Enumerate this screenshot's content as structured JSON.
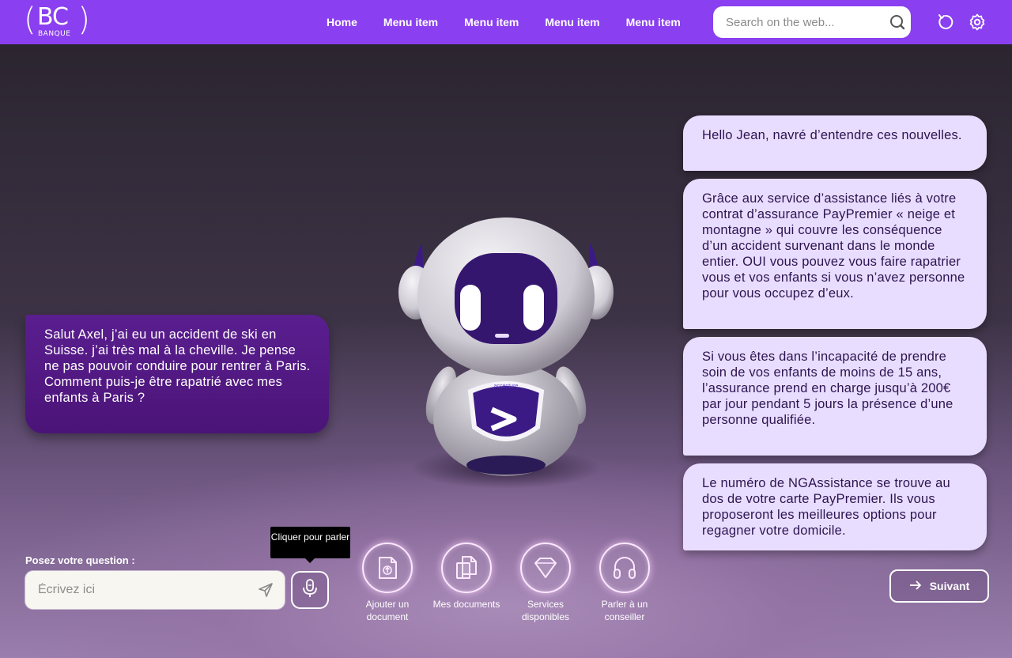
{
  "header": {
    "logo": {
      "text": "BC",
      "subtext": "BANQUE"
    },
    "nav": [
      "Home",
      "Menu item",
      "Menu item",
      "Menu item",
      "Menu item"
    ],
    "search_placeholder": "Search on the web...",
    "icons": [
      "search-icon",
      "refresh-icon",
      "settings-icon"
    ],
    "brand_color": "#8a3ff0"
  },
  "chat": {
    "user_message": " Salut Axel, j’ai eu un accident de ski en Suisse. j’ai très mal à la cheville. Je pense ne pas pouvoir conduire pour rentrer à Paris. Comment puis-je être rapatrié avec mes enfants à Paris ?",
    "bot_messages": [
      "Hello Jean, navré d’entendre ces nouvelles.",
      "Grâce aux service d’assistance liés à votre contrat d’assurance PayPremier « neige et montagne » qui couvre les conséquence d’un accident survenant dans le monde entier. OUI vous pouvez vous faire rapatrier vous et vos enfants si vous n’avez personne pour vous occupez d’eux.",
      "Si vous êtes dans l’incapacité de prendre soin de vos enfants de moins de 15 ans, l’assurance prend en charge jusqu’à 200€ par jour pendant 5 jours la présence d’une personne qualifiée.",
      "Le numéro de NGAssistance se trouve au dos de votre carte PayPremier. Ils vous proposeront les meilleures options pour regagner votre domicile."
    ],
    "user_bubble_color": "#5a1e8f",
    "bot_bubble_color": "#e9ddff"
  },
  "question": {
    "label": "Posez votre question :",
    "placeholder": "Écrivez ici",
    "mic_tooltip": "Cliquer pour parler"
  },
  "actions": [
    {
      "label": "Ajouter un document",
      "icon": "upload-document-icon"
    },
    {
      "label": "Mes documents",
      "icon": "documents-icon"
    },
    {
      "label": "Services disponibles",
      "icon": "gem-icon"
    },
    {
      "label": "Parler à un conseiller",
      "icon": "headphones-icon"
    }
  ],
  "next_button": "Suivant",
  "robot": {
    "chest_brand": "accenture"
  }
}
